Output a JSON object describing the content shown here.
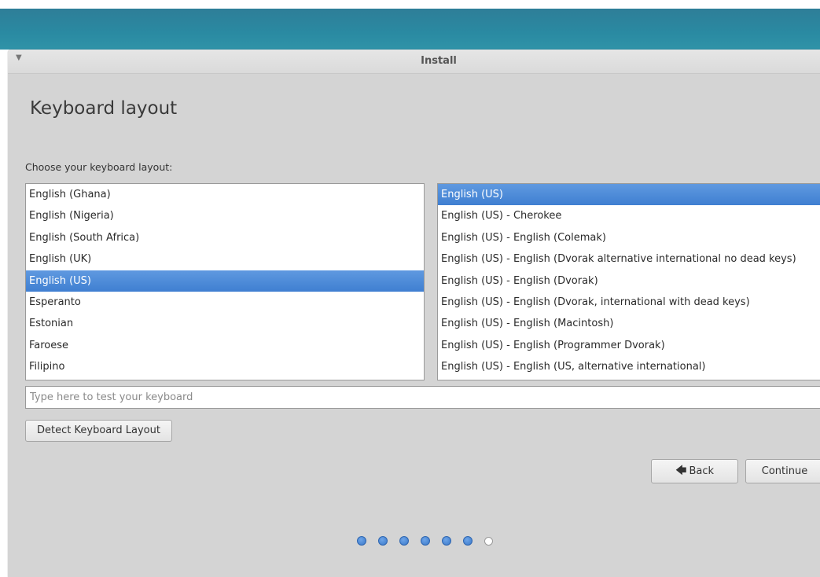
{
  "window": {
    "title": "Install",
    "menu_icon": "chevron-down-icon"
  },
  "page": {
    "title": "Keyboard layout",
    "choose_label": "Choose your keyboard layout:"
  },
  "layouts": {
    "items": [
      {
        "label": "English (Ghana)"
      },
      {
        "label": "English (Nigeria)"
      },
      {
        "label": "English (South Africa)"
      },
      {
        "label": "English (UK)"
      },
      {
        "label": "English (US)",
        "selected": true
      },
      {
        "label": "Esperanto"
      },
      {
        "label": "Estonian"
      },
      {
        "label": "Faroese"
      },
      {
        "label": "Filipino"
      }
    ]
  },
  "variants": {
    "items": [
      {
        "label": "English (US)",
        "selected": true
      },
      {
        "label": "English (US) - Cherokee"
      },
      {
        "label": "English (US) - English (Colemak)"
      },
      {
        "label": "English (US) - English (Dvorak alternative international no dead keys)"
      },
      {
        "label": "English (US) - English (Dvorak)"
      },
      {
        "label": "English (US) - English (Dvorak, international with dead keys)"
      },
      {
        "label": "English (US) - English (Macintosh)"
      },
      {
        "label": "English (US) - English (Programmer Dvorak)"
      },
      {
        "label": "English (US) - English (US, alternative international)"
      }
    ]
  },
  "test_field": {
    "placeholder": "Type here to test your keyboard",
    "value": ""
  },
  "buttons": {
    "detect": "Detect Keyboard Layout",
    "back": "Back",
    "back_icon": "back-arrow-icon",
    "continue": "Continue"
  },
  "progress": {
    "total_steps": 7,
    "completed_steps": 6
  },
  "colors": {
    "desktop": "#2a8aa2",
    "selection": "#4a88d6",
    "window_bg": "#d4d4d4"
  }
}
